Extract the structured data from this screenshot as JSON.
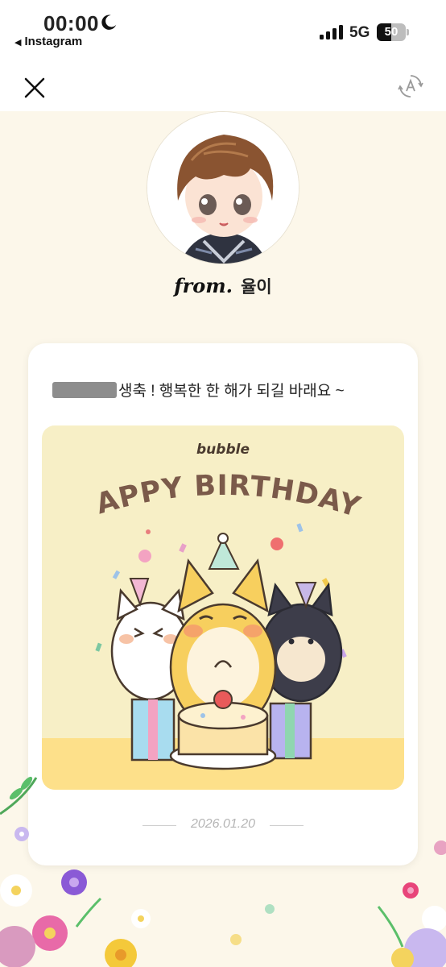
{
  "status_bar": {
    "time": "00:00",
    "back_app": "Instagram",
    "network": "5G",
    "battery": "50",
    "battery_level": 0.5
  },
  "nav": {
    "close_icon": "close-icon",
    "translate_icon": "translate-icon"
  },
  "profile": {
    "from_label": "from.",
    "name": "율이"
  },
  "card": {
    "message": "생축 ! 행복한 한 해가 되길 바래요 ~",
    "image": {
      "brand": "bubble",
      "headline": "HAPPY BIRTHDAY!"
    },
    "date": "2026.01.20"
  },
  "colors": {
    "page_bg": "#fcf7ea",
    "image_bg": "#f7efc6",
    "headline": "#7b5a4a"
  }
}
